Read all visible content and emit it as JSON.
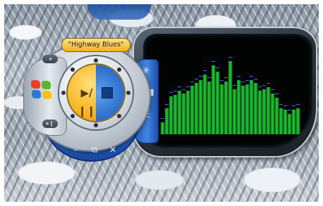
{
  "player": {
    "track_title": "\"Highway Blues\"",
    "play_pause_symbol": "▶/❙❙",
    "buttons": {
      "minimize": "–",
      "switch_mode": "⧉",
      "close": "✕",
      "previous": "◂",
      "next": "▸❙"
    },
    "side_buttons": {
      "visualization": "✳",
      "equalizer": "▃▅▇",
      "playlist": "☰"
    }
  },
  "colors": {
    "accent_orange": "#f7b21c",
    "accent_blue": "#2b6cc8",
    "visualizer_bar": "#25c43a",
    "visualizer_peak": "#3b6bd8"
  },
  "icons": [
    "windows-logo-icon",
    "visualization-icon",
    "equalizer-icon",
    "playlist-icon",
    "minimize-icon",
    "switch-mode-icon",
    "close-icon",
    "previous-icon",
    "next-icon",
    "play-pause-icon",
    "stop-icon"
  ],
  "visualizer_levels": [
    0.16,
    0.36,
    0.52,
    0.54,
    0.6,
    0.56,
    0.6,
    0.66,
    0.7,
    0.74,
    0.82,
    0.72,
    0.94,
    0.86,
    0.68,
    0.72,
    1.0,
    0.62,
    0.74,
    0.66,
    0.68,
    0.74,
    0.7,
    0.6,
    0.62,
    0.64,
    0.56,
    0.5,
    0.36,
    0.34,
    0.28,
    0.34,
    0.36
  ]
}
